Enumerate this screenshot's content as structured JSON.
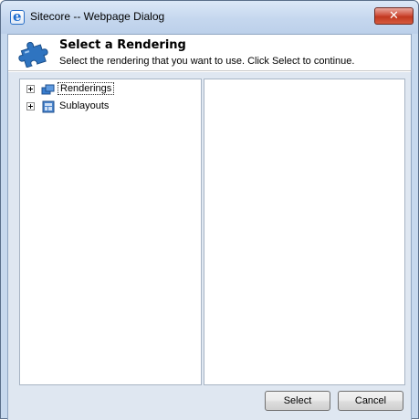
{
  "window": {
    "title": "Sitecore -- Webpage Dialog",
    "close_glyph": "✕"
  },
  "header": {
    "title": "Select a Rendering",
    "subtitle": "Select the rendering that you want to use. Click Select to continue.",
    "icon": "puzzle-piece-icon"
  },
  "tree": {
    "items": [
      {
        "label": "Renderings",
        "icon": "renderings-folder-icon",
        "expander": "plus",
        "selected": true
      },
      {
        "label": "Sublayouts",
        "icon": "sublayouts-folder-icon",
        "expander": "plus",
        "selected": false
      }
    ]
  },
  "buttons": {
    "select_label": "Select",
    "cancel_label": "Cancel"
  },
  "colors": {
    "frame": "#c7d9ee",
    "content_bg": "#dfe7f1",
    "close_button": "#c13820",
    "puzzle_icon": "#2f74c0"
  }
}
